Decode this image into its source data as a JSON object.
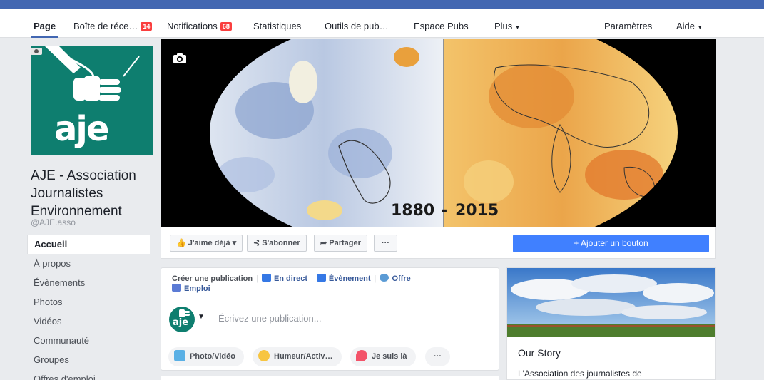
{
  "tabs": [
    {
      "label": "Page",
      "active": true
    },
    {
      "label": "Boîte de réce…",
      "badge": "14"
    },
    {
      "label": "Notifications",
      "badge": "68"
    },
    {
      "label": "Statistiques"
    },
    {
      "label": "Outils de pub…"
    },
    {
      "label": "Espace Pubs"
    },
    {
      "label": "Plus",
      "dropdown": true
    },
    {
      "label": "Paramètres"
    },
    {
      "label": "Aide",
      "dropdown": true
    }
  ],
  "logo": {
    "text": "aje"
  },
  "page": {
    "name": "AJE - Association Journalistes Environnement",
    "handle": "@AJE.asso"
  },
  "nav": [
    "Accueil",
    "À propos",
    "Évènements",
    "Photos",
    "Vidéos",
    "Communauté",
    "Groupes",
    "Offres d'emploi"
  ],
  "cover": {
    "year_left": "1880",
    "year_right": "2015"
  },
  "actions": {
    "like": "J'aime déjà",
    "subscribe": "S'abonner",
    "share": "Partager",
    "more": "···",
    "add_button": "+ Ajouter un bouton"
  },
  "composer": {
    "create": "Créer une publication",
    "live": "En direct",
    "event": "Évènement",
    "offer": "Offre",
    "job": "Emploi",
    "placeholder": "Écrivez une publication...",
    "photo": "Photo/Vidéo",
    "mood": "Humeur/Activ…",
    "checkin": "Je suis là",
    "more": "···"
  },
  "story": {
    "title": "Our Story",
    "text": "L'Association des journalistes de"
  },
  "colors": {
    "brand": "#4267b2",
    "accent_button": "#4080ff",
    "logo_bg": "#0e7e6f",
    "badge": "#fa3e3e"
  }
}
